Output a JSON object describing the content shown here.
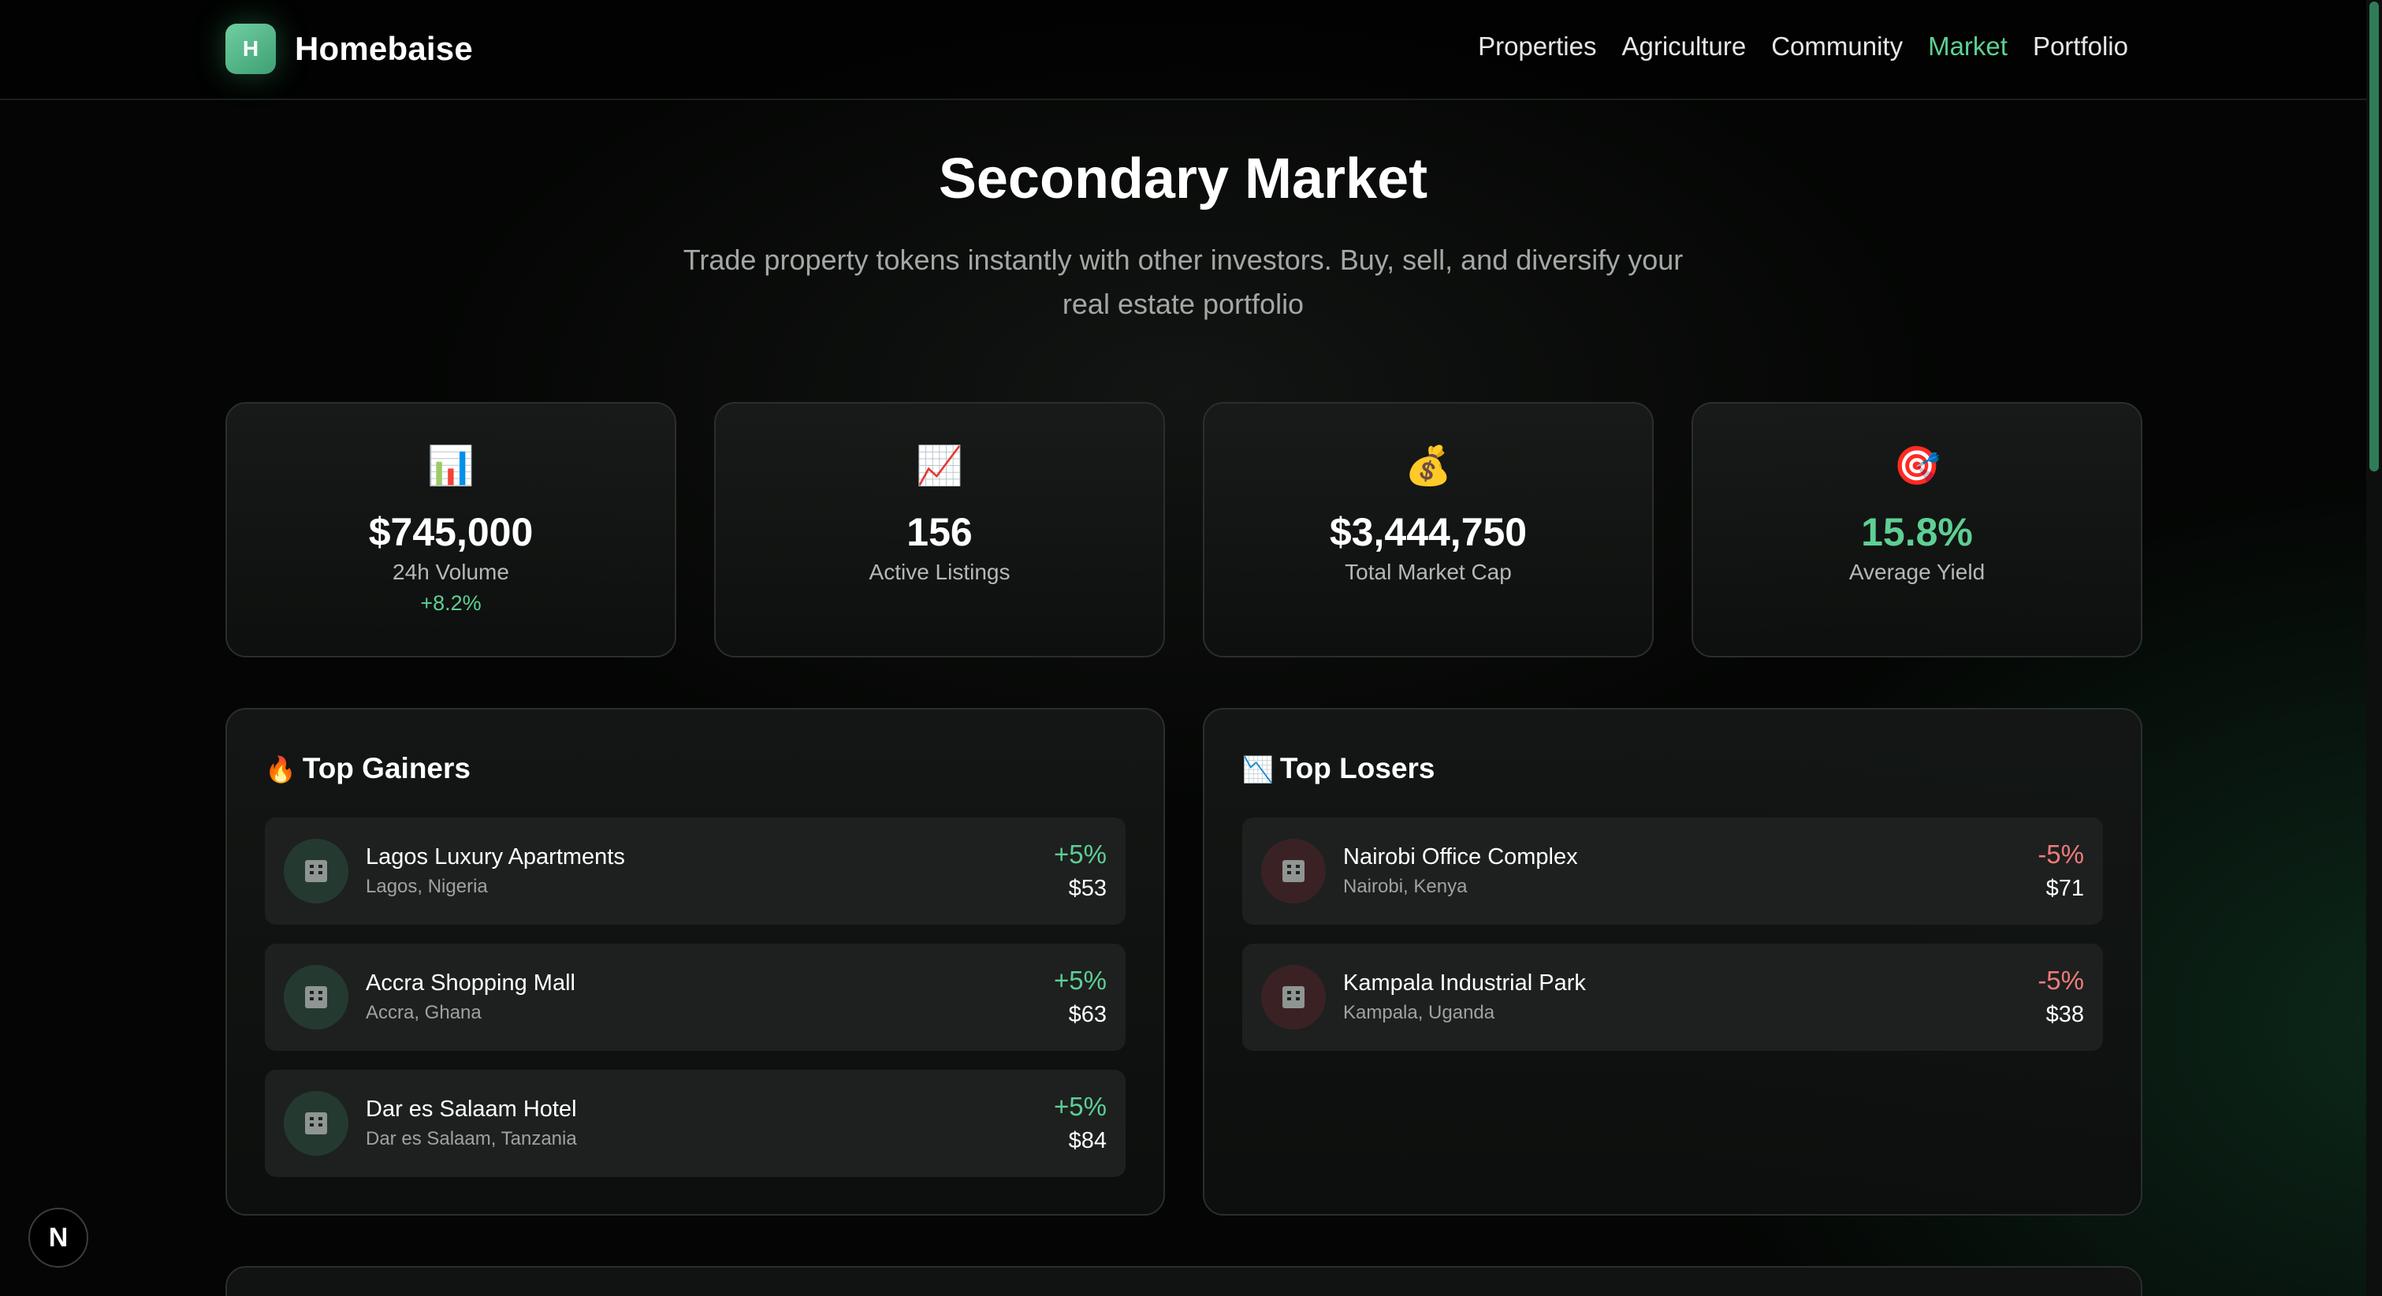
{
  "nav": {
    "logo_letter": "H",
    "brand": "Homebaise",
    "links": [
      "Properties",
      "Agriculture",
      "Community",
      "Market",
      "Portfolio"
    ],
    "active": "Market"
  },
  "hero": {
    "title": "Secondary Market",
    "subtitle": "Trade property tokens instantly with other investors. Buy, sell, and diversify your real estate portfolio"
  },
  "stats": [
    {
      "icon": "📊",
      "icon_name": "bar-chart-icon",
      "value": "$745,000",
      "label": "24h Volume",
      "change": "+8.2%"
    },
    {
      "icon": "📈",
      "icon_name": "chart-increasing-icon",
      "value": "156",
      "label": "Active Listings"
    },
    {
      "icon": "💰",
      "icon_name": "money-bag-icon",
      "value": "$3,444,750",
      "label": "Total Market Cap"
    },
    {
      "icon": "🎯",
      "icon_name": "target-icon",
      "value": "15.8%",
      "label": "Average Yield"
    }
  ],
  "gainers": {
    "icon": "🔥",
    "title": "Top Gainers",
    "items": [
      {
        "name": "Lagos Luxury Apartments",
        "location": "Lagos, Nigeria",
        "change": "+5%",
        "price": "$53"
      },
      {
        "name": "Accra Shopping Mall",
        "location": "Accra, Ghana",
        "change": "+5%",
        "price": "$63"
      },
      {
        "name": "Dar es Salaam Hotel",
        "location": "Dar es Salaam, Tanzania",
        "change": "+5%",
        "price": "$84"
      }
    ]
  },
  "losers": {
    "icon": "📉",
    "title": "Top Losers",
    "items": [
      {
        "name": "Nairobi Office Complex",
        "location": "Nairobi, Kenya",
        "change": "-5%",
        "price": "$71"
      },
      {
        "name": "Kampala Industrial Park",
        "location": "Kampala, Uganda",
        "change": "-5%",
        "price": "$38"
      }
    ]
  },
  "dev_badge": "N",
  "colors": {
    "accent": "#5ecf94",
    "negative": "#f07b7b",
    "background": "#040504"
  }
}
